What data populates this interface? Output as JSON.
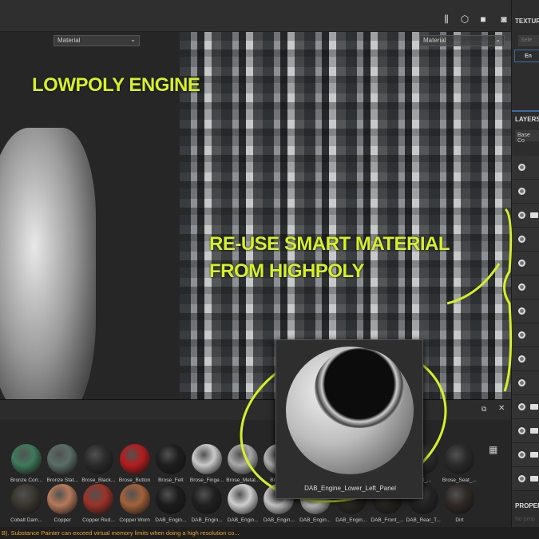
{
  "toolbar": {
    "icons": [
      "symmetry-icon",
      "camera-view-icon",
      "video-icon",
      "screenshot-icon"
    ]
  },
  "viewport3d": {
    "mode": "Material"
  },
  "viewportUV": {
    "mode": "Material"
  },
  "annotations": {
    "lowpoly": "LOWPOLY ENGINE",
    "reuse_line1": "RE-USE SMART MATERIAL",
    "reuse_line2": "FROM HIGHPOLY",
    "accent": "#d6f02a"
  },
  "right": {
    "texture_title": "TEXTUR",
    "select_btn": "Sele",
    "texture_set": "En",
    "layers_title": "LAYERS",
    "channel": "Base Co",
    "properties_title": "PROPER",
    "properties_empty": "No prop"
  },
  "shelf": {
    "row1": [
      {
        "label": "Bronze Corr...",
        "color": "#3f7a5c"
      },
      {
        "label": "Bronze Stat...",
        "color": "#5a6e66"
      },
      {
        "label": "Brose_Black...",
        "color": "#2a2a2a"
      },
      {
        "label": "Brose_Button",
        "color": "#b41d1d"
      },
      {
        "label": "Brose_Felt",
        "color": "#1e1e1e"
      },
      {
        "label": "Brose_Finge...",
        "color": "#c9c9c9"
      },
      {
        "label": "Brose_Metal...",
        "color": "#a9a9a9"
      },
      {
        "label": "Brose...",
        "color": "#b0b0b0"
      },
      {
        "label": "",
        "color": "#444"
      },
      {
        "label": "",
        "color": "#444"
      },
      {
        "label": "",
        "color": "#333"
      },
      {
        "label": "...at_...",
        "color": "#2c2c2c"
      },
      {
        "label": "Brose_Seat_...",
        "color": "#2a2a2a"
      }
    ],
    "row2": [
      {
        "label": "Cobalt Dam...",
        "color": "#3a3630"
      },
      {
        "label": "Copper",
        "color": "#b67a5a"
      },
      {
        "label": "Copper Red...",
        "color": "#9b3328"
      },
      {
        "label": "Copper Worn",
        "color": "#a2623a"
      },
      {
        "label": "DAB_Engin...",
        "color": "#1c1c1c"
      },
      {
        "label": "DAB_Engin...",
        "color": "#202020"
      },
      {
        "label": "DAB_Engin...",
        "color": "#cfcfcf"
      },
      {
        "label": "DAB_Engin...",
        "color": "#c4c4c4"
      },
      {
        "label": "DAB_Engin...",
        "color": "#bdbdbd"
      },
      {
        "label": "DAB_Engin...",
        "color": "#2a2824"
      },
      {
        "label": "DAB_Front_...",
        "color": "#28251f"
      },
      {
        "label": "DAB_Rear_T...",
        "color": "#242424"
      },
      {
        "label": "Dirt",
        "color": "#2e2925"
      }
    ]
  },
  "popup": {
    "label": "DAB_Engine_Lower_Left_Panel"
  },
  "status": {
    "message": "B). Substance Painter can exceed virtual memory limits when doing a high resolution co..."
  }
}
